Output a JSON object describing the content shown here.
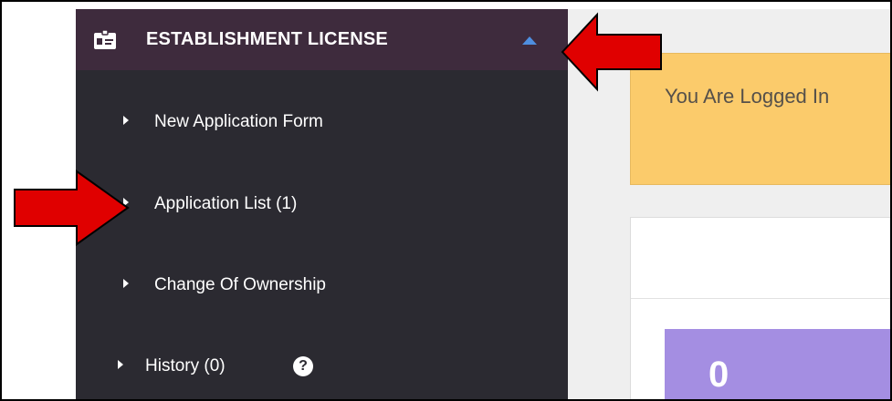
{
  "sidebar": {
    "header": {
      "title": "ESTABLISHMENT LICENSE",
      "icon": "id-card-icon",
      "toggle_icon": "caret-up-icon"
    },
    "items": [
      {
        "label": "New Application Form"
      },
      {
        "label": "Application List (1)"
      },
      {
        "label": "Change Of Ownership"
      },
      {
        "label": "History (0)",
        "help_icon": "question-circle-icon",
        "help_symbol": "?"
      }
    ]
  },
  "main": {
    "alert": {
      "text": "You Are Logged In"
    },
    "stat_card": {
      "value": "0"
    }
  },
  "annotations": {
    "arrow_color": "#e00000"
  },
  "colors": {
    "sidebar_bg": "#2b2a31",
    "header_bg": "#3e2b3d",
    "alert_bg": "#fbcb6b",
    "stat_card_bg": "#a48ee2",
    "caret": "#4e8fe0"
  }
}
